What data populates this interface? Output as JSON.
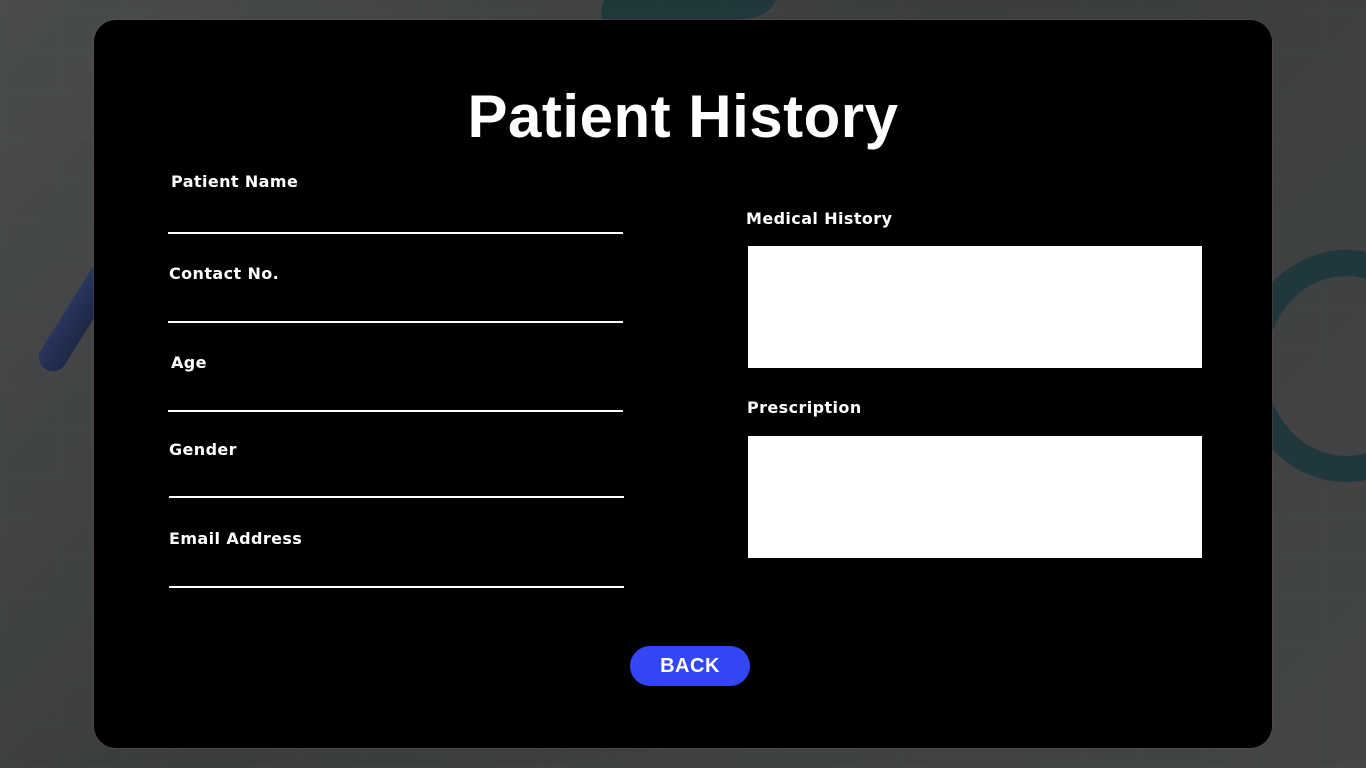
{
  "page": {
    "title": "Patient History"
  },
  "form": {
    "left_fields": [
      {
        "label": "Patient Name",
        "value": ""
      },
      {
        "label": "Contact No.",
        "value": ""
      },
      {
        "label": "Age",
        "value": ""
      },
      {
        "label": "Gender",
        "value": ""
      },
      {
        "label": "Email Address",
        "value": ""
      }
    ],
    "medical_history": {
      "label": "Medical History",
      "value": ""
    },
    "prescription": {
      "label": "Prescription",
      "value": ""
    }
  },
  "actions": {
    "back_label": "BACK"
  },
  "colors": {
    "card_background": "#000000",
    "button_accent": "#3346f5",
    "text": "#ffffff",
    "textarea_background": "#ffffff"
  }
}
